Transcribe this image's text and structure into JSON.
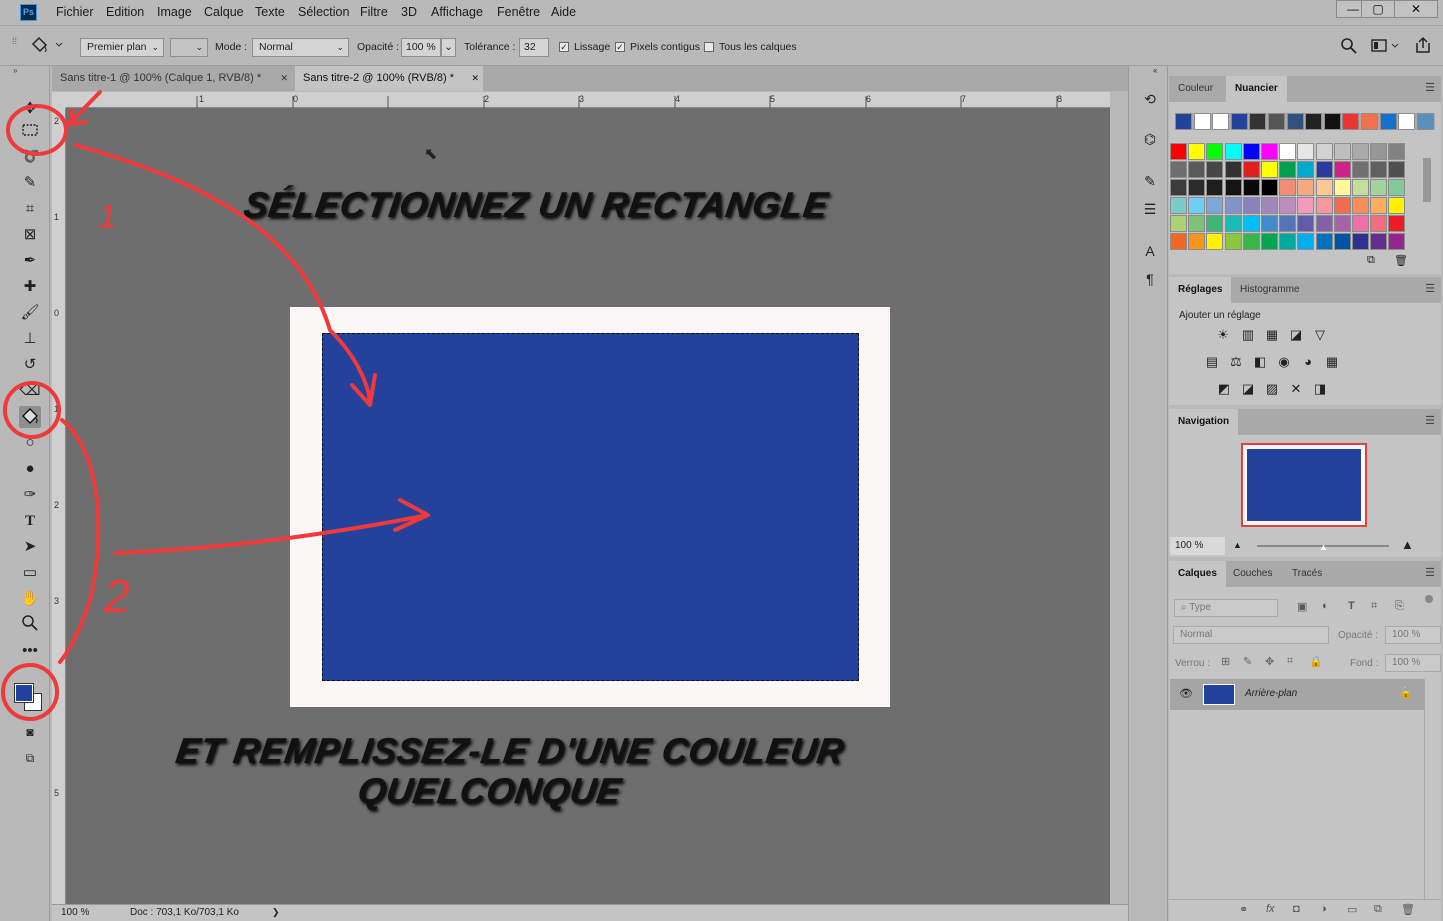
{
  "app": {
    "logo_text": "Ps"
  },
  "menu": [
    "Fichier",
    "Edition",
    "Image",
    "Calque",
    "Texte",
    "Sélection",
    "Filtre",
    "3D",
    "Affichage",
    "Fenêtre",
    "Aide"
  ],
  "window_controls": {
    "minimize": "—",
    "restore": "▢",
    "close": "✕"
  },
  "options": {
    "fill_source": "Premier plan",
    "mode_label": "Mode :",
    "mode_value": "Normal",
    "opacity_label": "Opacité :",
    "opacity_value": "100 %",
    "tolerance_label": "Tolérance :",
    "tolerance_value": "32",
    "antialias_label": "Lissage",
    "contiguous_label": "Pixels contigus",
    "all_layers_label": "Tous les calques",
    "antialias_checked": true,
    "contiguous_checked": true,
    "all_layers_checked": false
  },
  "tabs": [
    {
      "label": "Sans titre-1 @ 100% (Calque 1, RVB/8) *",
      "close": "✕",
      "active": false
    },
    {
      "label": "Sans titre-2 @ 100% (RVB/8) *",
      "close": "✕",
      "active": true
    }
  ],
  "rulers": {
    "h_labels": [
      "1",
      "0",
      "2",
      "3",
      "4",
      "5",
      "6",
      "7",
      "8"
    ],
    "v_labels": [
      "2",
      "1",
      "0",
      "1",
      "2",
      "3",
      "4",
      "5"
    ]
  },
  "annotations": {
    "step1_text": "SÉLECTIONNEZ UN RECTANGLE",
    "step2_line1": "ET REMPLISSEZ-LE D'UNE COULEUR",
    "step2_line2": "QUELCONQUE",
    "marker1": "1",
    "marker2": "2",
    "color": "#ee3a3a"
  },
  "document": {
    "fill_color": "#24419b",
    "paper_color": "#faf7f6"
  },
  "status": {
    "zoom": "100 %",
    "doc_info": "Doc : 703,1 Ko/703,1 Ko",
    "arrow": "❯"
  },
  "panels": {
    "color_tabs": [
      "Couleur",
      "Nuancier"
    ],
    "swatch_recent": [
      "#24419b",
      "#ffffff",
      "#ffffff",
      "#24419b",
      "#333333",
      "#555555",
      "#33507f",
      "#222222",
      "#111111",
      "#e33",
      "#f07050",
      "#1470c8",
      "#ffffff",
      "#5b8fc0"
    ],
    "swatch_rows": [
      [
        "#ff0000",
        "#ffff00",
        "#00ff00",
        "#00ffff",
        "#0000ff",
        "#ff00ff",
        "#ffffff",
        "#e6e6e6",
        "#d2d2d2",
        "#bebebe",
        "#aaaaaa",
        "#969696",
        "#828282"
      ],
      [
        "#6e6e6e",
        "#5a5a5a",
        "#464646",
        "#323232",
        "#e02020",
        "#ffff00",
        "#00a050",
        "#00aacc",
        "#2a3aa0",
        "#d0208a",
        "#707070",
        "#606060",
        "#505050"
      ],
      [
        "#3c3c3c",
        "#2b2b2b",
        "#1e1e1e",
        "#141414",
        "#0a0a0a",
        "#000000",
        "#f08c78",
        "#f5a882",
        "#fbc895",
        "#fff799",
        "#c4df9b",
        "#a3d39c",
        "#82ca9c"
      ],
      [
        "#7accc8",
        "#6dcff6",
        "#7da7d9",
        "#8393ca",
        "#8781bd",
        "#a186be",
        "#bc8dbf",
        "#f49ac1",
        "#f5989d",
        "#f26c4f",
        "#f68e56",
        "#fbaf5d",
        "#fff200"
      ],
      [
        "#acd373",
        "#7cc576",
        "#3bb878",
        "#1abbb4",
        "#00bff3",
        "#438ccb",
        "#5574b9",
        "#605ca8",
        "#855fa8",
        "#a763a8",
        "#f06ea9",
        "#f26d7d",
        "#ed1c24"
      ],
      [
        "#f26522",
        "#f7941d",
        "#fff200",
        "#8dc63f",
        "#39b54a",
        "#00a651",
        "#00a99d",
        "#00aeef",
        "#0072bc",
        "#0054a6",
        "#2e3192",
        "#662d91",
        "#92278f"
      ]
    ],
    "adjust_tabs": [
      "Réglages",
      "Histogramme"
    ],
    "adjust_title": "Ajouter un réglage",
    "adjust_icons_row1": [
      "☀",
      "▥",
      "▦",
      "◪",
      "▽"
    ],
    "adjust_icons_row2": [
      "▤",
      "⚖",
      "◧",
      "◉",
      "◕",
      "▦"
    ],
    "adjust_icons_row3": [
      "◩",
      "◪",
      "▨",
      "✕",
      "◨"
    ],
    "nav_tab": "Navigation",
    "nav_zoom": "100 %",
    "layers_tabs": [
      "Calques",
      "Couches",
      "Tracés"
    ],
    "layers_filter": "Type",
    "layers_blend": "Normal",
    "layers_opacity_label": "Opacité :",
    "layers_opacity": "100 %",
    "layers_lock_label": "Verrou :",
    "layers_fill_label": "Fond :",
    "layers_fill": "100 %",
    "layer_name": "Arrière-plan"
  }
}
